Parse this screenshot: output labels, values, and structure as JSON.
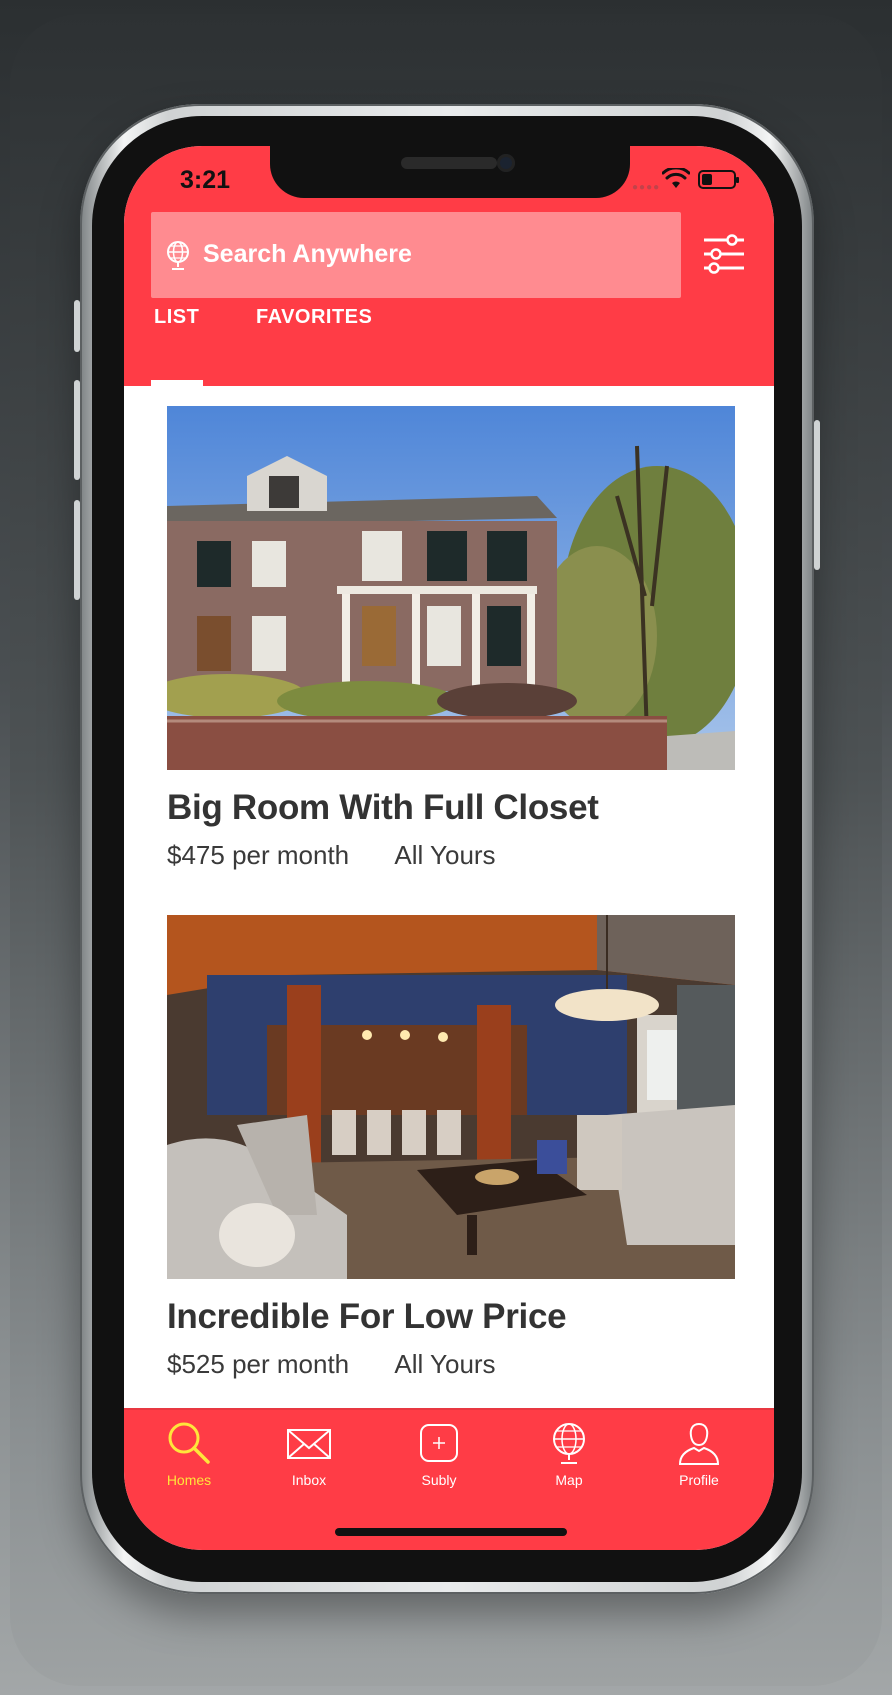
{
  "status_bar": {
    "time": "3:21"
  },
  "search": {
    "placeholder": "Search Anywhere"
  },
  "tabs": [
    {
      "label": "LIST",
      "active": true
    },
    {
      "label": "FAVORITES",
      "active": false
    }
  ],
  "listings": [
    {
      "title": "Big Room With Full Closet",
      "price": "$475 per month",
      "type": "All Yours",
      "image": "brick-townhouse-exterior"
    },
    {
      "title": "Incredible For Low Price",
      "price": "$525 per month",
      "type": "All Yours",
      "image": "apartment-lounge-interior"
    }
  ],
  "bottom_nav": [
    {
      "label": "Homes",
      "icon": "search-icon",
      "active": true
    },
    {
      "label": "Inbox",
      "icon": "mail-icon",
      "active": false
    },
    {
      "label": "Subly",
      "icon": "add-icon",
      "active": false
    },
    {
      "label": "Map",
      "icon": "globe-icon",
      "active": false
    },
    {
      "label": "Profile",
      "icon": "person-icon",
      "active": false
    }
  ],
  "colors": {
    "brand": "#ff3c46",
    "search_bg": "#ff8b90",
    "active_nav": "#ffe53b",
    "text": "#333333"
  }
}
